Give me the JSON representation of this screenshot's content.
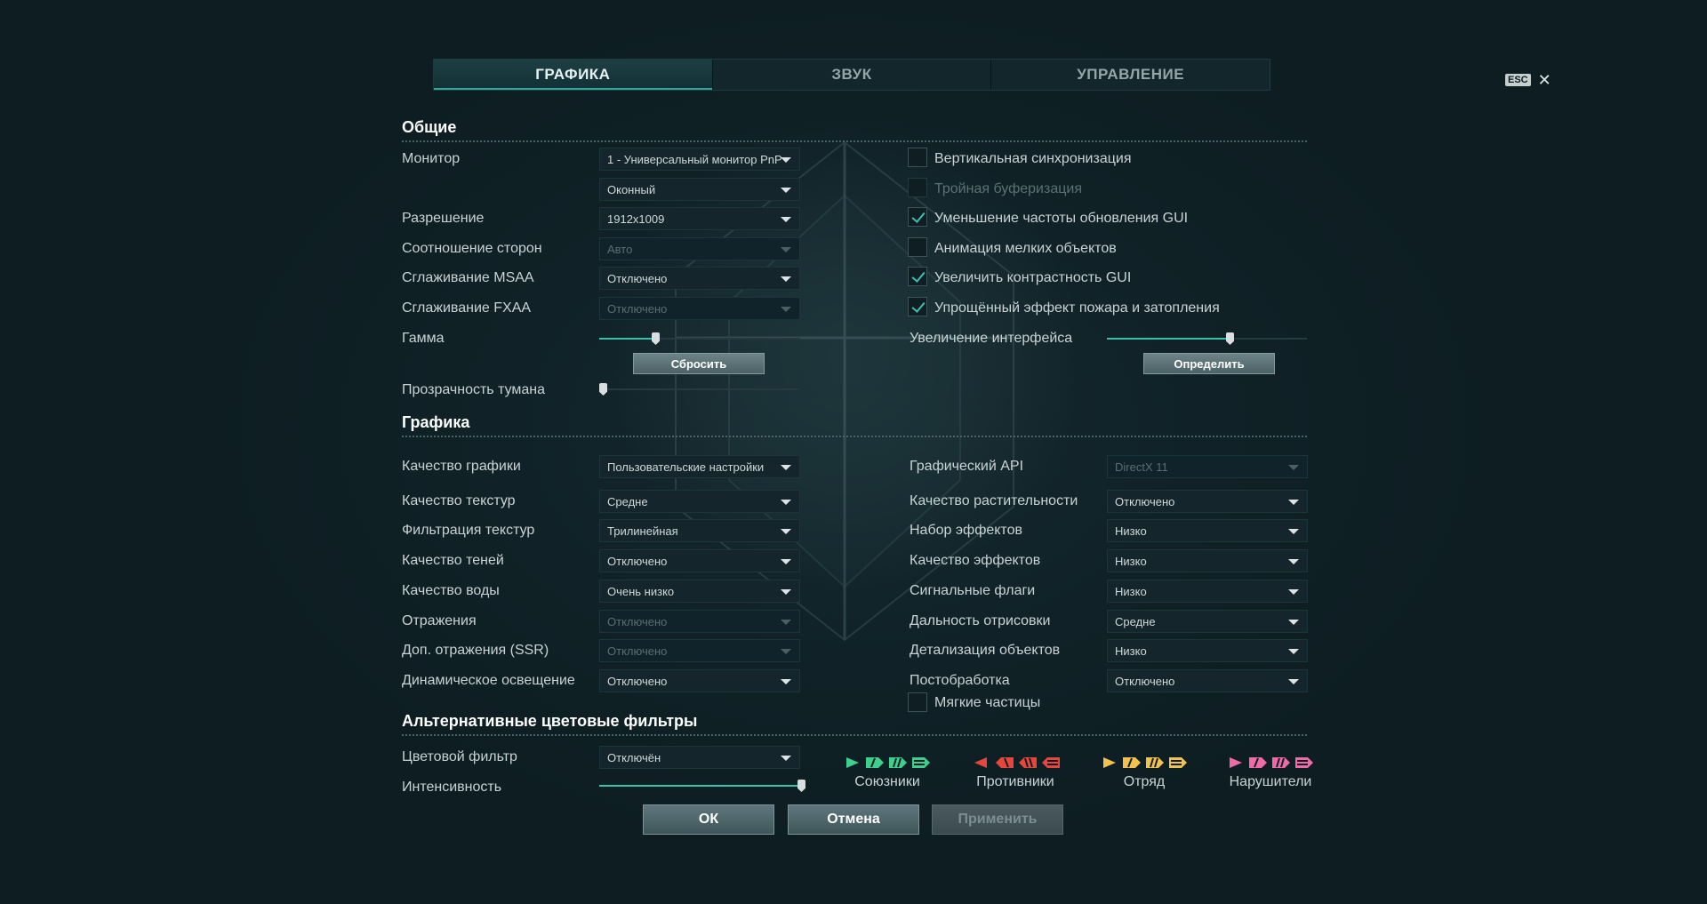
{
  "tabs": [
    "ГРАФИКА",
    "ЗВУК",
    "УПРАВЛЕНИЕ"
  ],
  "esc": {
    "key": "ESC",
    "close": "✕"
  },
  "sections": {
    "general": "Общие",
    "graphics": "Графика",
    "filters": "Альтернативные цветовые фильтры"
  },
  "general": {
    "monitor_label": "Монитор",
    "monitor_value": "1 - Универсальный монитор PnP",
    "mode_value": "Оконный",
    "resolution_label": "Разрешение",
    "resolution_value": "1912x1009",
    "aspect_label": "Соотношение сторон",
    "aspect_value": "Авто",
    "msaa_label": "Сглаживание MSAA",
    "msaa_value": "Отключено",
    "fxaa_label": "Сглаживание FXAA",
    "fxaa_value": "Отключено",
    "gamma_label": "Гамма",
    "gamma_level": 0.27,
    "reset_button": "Сбросить",
    "fog_label": "Прозрачность тумана",
    "fog_level": 0.0,
    "vsync_label": "Вертикальная синхронизация",
    "triple_label": "Тройная буферизация",
    "gui_rate_label": "Уменьшение частоты обновления GUI",
    "small_anim_label": "Анимация мелких объектов",
    "gui_contrast_label": "Увеличить контрастность GUI",
    "fire_label": "Упрощённый эффект пожара и затопления",
    "ui_scale_label": "Увеличение интерфейса",
    "ui_scale_level": 0.62,
    "detect_button": "Определить"
  },
  "graphics": {
    "left": [
      {
        "label": "Качество графики",
        "value": "Пользовательские настройки",
        "disabled": false
      },
      {
        "label": "Качество текстур",
        "value": "Средне",
        "disabled": false
      },
      {
        "label": "Фильтрация текстур",
        "value": "Трилинейная",
        "disabled": false
      },
      {
        "label": "Качество теней",
        "value": "Отключено",
        "disabled": false
      },
      {
        "label": "Качество воды",
        "value": "Очень низко",
        "disabled": false
      },
      {
        "label": "Отражения",
        "value": "Отключено",
        "disabled": true
      },
      {
        "label": "Доп. отражения (SSR)",
        "value": "Отключено",
        "disabled": true
      },
      {
        "label": "Динамическое освещение",
        "value": "Отключено",
        "disabled": false
      }
    ],
    "right": [
      {
        "label": "Графический API",
        "value": "DirectX 11",
        "disabled": true
      },
      {
        "label": "Качество растительности",
        "value": "Отключено",
        "disabled": false
      },
      {
        "label": "Набор эффектов",
        "value": "Низко",
        "disabled": false
      },
      {
        "label": "Качество эффектов",
        "value": "Низко",
        "disabled": false
      },
      {
        "label": "Сигнальные флаги",
        "value": "Низко",
        "disabled": false
      },
      {
        "label": "Дальность отрисовки",
        "value": "Средне",
        "disabled": false
      },
      {
        "label": "Детализация объектов",
        "value": "Низко",
        "disabled": false
      },
      {
        "label": "Постобработка",
        "value": "Отключено",
        "disabled": false
      }
    ],
    "soft_particles_label": "Мягкие частицы"
  },
  "filters": {
    "color_filter_label": "Цветовой фильтр",
    "color_filter_value": "Отключён",
    "intensity_label": "Интенсивность",
    "intensity_level": 1.0,
    "groups": [
      {
        "name": "Союзники",
        "color": "#3ccf8e"
      },
      {
        "name": "Противники",
        "color": "#e8463c"
      },
      {
        "name": "Отряд",
        "color": "#f2c14e"
      },
      {
        "name": "Нарушители",
        "color": "#f06aa8"
      }
    ]
  },
  "buttons": {
    "ok": "ОК",
    "cancel": "Отмена",
    "apply": "Применить"
  }
}
